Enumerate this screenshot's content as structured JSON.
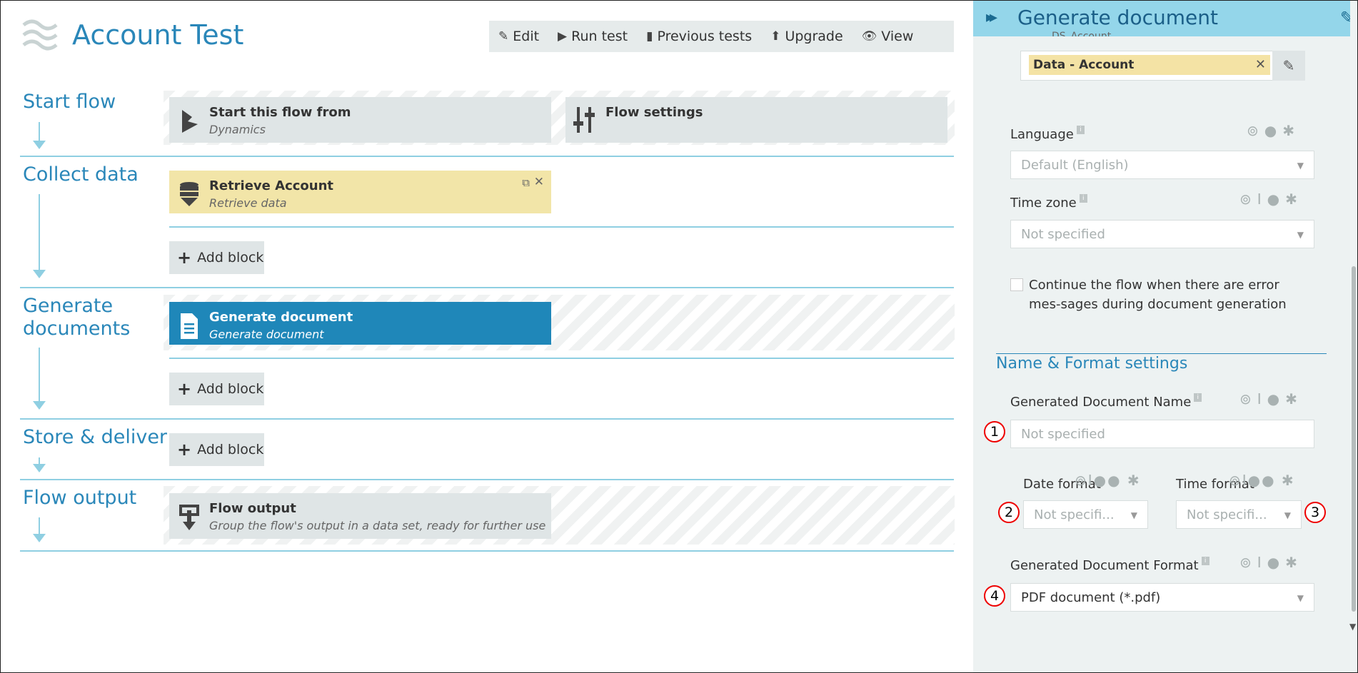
{
  "app": {
    "title": "Account Test"
  },
  "toolbar": {
    "edit": "Edit",
    "run_test": "Run test",
    "previous_tests": "Previous tests",
    "upgrade": "Upgrade",
    "view": "View"
  },
  "sections": {
    "start_flow": "Start flow",
    "collect_data": "Collect data",
    "generate_documents": "Generate documents",
    "store_deliver": "Store & deliver",
    "flow_output": "Flow output"
  },
  "blocks": {
    "start": {
      "title": "Start this flow from",
      "subtitle": "Dynamics"
    },
    "settings": {
      "title": "Flow settings"
    },
    "retrieve": {
      "title": "Retrieve Account",
      "subtitle": "Retrieve data"
    },
    "generate": {
      "title": "Generate document",
      "subtitle": "Generate document"
    },
    "output": {
      "title": "Flow output",
      "subtitle": "Group the flow's output in a data set, ready for further use"
    }
  },
  "add_block_label": "Add block",
  "panel": {
    "title": "Generate document",
    "cut_label": "DS_Account",
    "dataset_tag": "Data - Account",
    "language": {
      "label": "Language",
      "value": "Default (English)"
    },
    "timezone": {
      "label": "Time zone",
      "value": "Not specified"
    },
    "continue_checkbox": "Continue the flow when there are error mes-sages during document generation",
    "name_format_section": "Name & Format settings",
    "doc_name": {
      "label": "Generated Document Name",
      "placeholder": "Not specified"
    },
    "date_format": {
      "label": "Date format",
      "value": "Not specifi..."
    },
    "time_format": {
      "label": "Time format",
      "value": "Not specifi..."
    },
    "doc_format": {
      "label": "Generated Document Format",
      "value": "PDF document (*.pdf)"
    }
  },
  "markers": [
    "1",
    "2",
    "3",
    "4"
  ],
  "colors": {
    "accent": "#2a87b9",
    "panel_header": "#94d6ea",
    "selected_block": "#1f87b9",
    "data_block": "#f2e5a8",
    "tag": "#f4e3a5"
  }
}
